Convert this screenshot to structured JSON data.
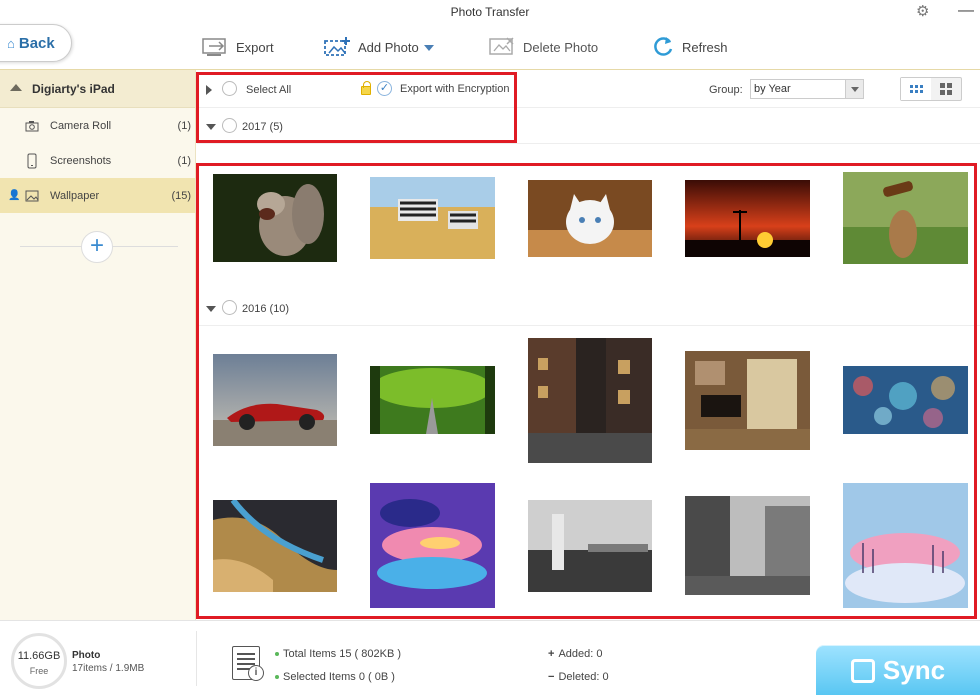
{
  "window": {
    "title": "Photo Transfer"
  },
  "toolbar": {
    "back_label": "Back",
    "export_label": "Export",
    "add_photo_label": "Add Photo",
    "delete_photo_label": "Delete Photo",
    "refresh_label": "Refresh"
  },
  "sidebar": {
    "device_name": "Digiarty's iPad",
    "items": [
      {
        "label": "Camera Roll",
        "count": "(1)",
        "icon": "camera-icon"
      },
      {
        "label": "Screenshots",
        "count": "(1)",
        "icon": "phone-icon"
      },
      {
        "label": "Wallpaper",
        "count": "(15)",
        "icon": "image-icon",
        "active": true
      }
    ]
  },
  "filter": {
    "select_all_label": "Select All",
    "export_encryption_label": "Export with Encryption",
    "group_label": "Group:",
    "group_value": "by Year"
  },
  "groups": [
    {
      "label": "2017 (5)"
    },
    {
      "label": "2016 (10)"
    }
  ],
  "status": {
    "free_amount": "11.66GB",
    "free_label": "Free",
    "media_label": "Photo",
    "media_items": "17items / 1.9MB",
    "total_items": "Total Items 15 ( 802KB )",
    "selected_items": "Selected Items 0 ( 0B )",
    "added": "Added: 0",
    "deleted": "Deleted: 0",
    "sync_label": "Sync"
  },
  "colors": {
    "accent": "#3a7fc2",
    "highlight_box": "#e01b24",
    "sidebar_active": "#f1e4b0",
    "sync": "#58c6f2"
  }
}
